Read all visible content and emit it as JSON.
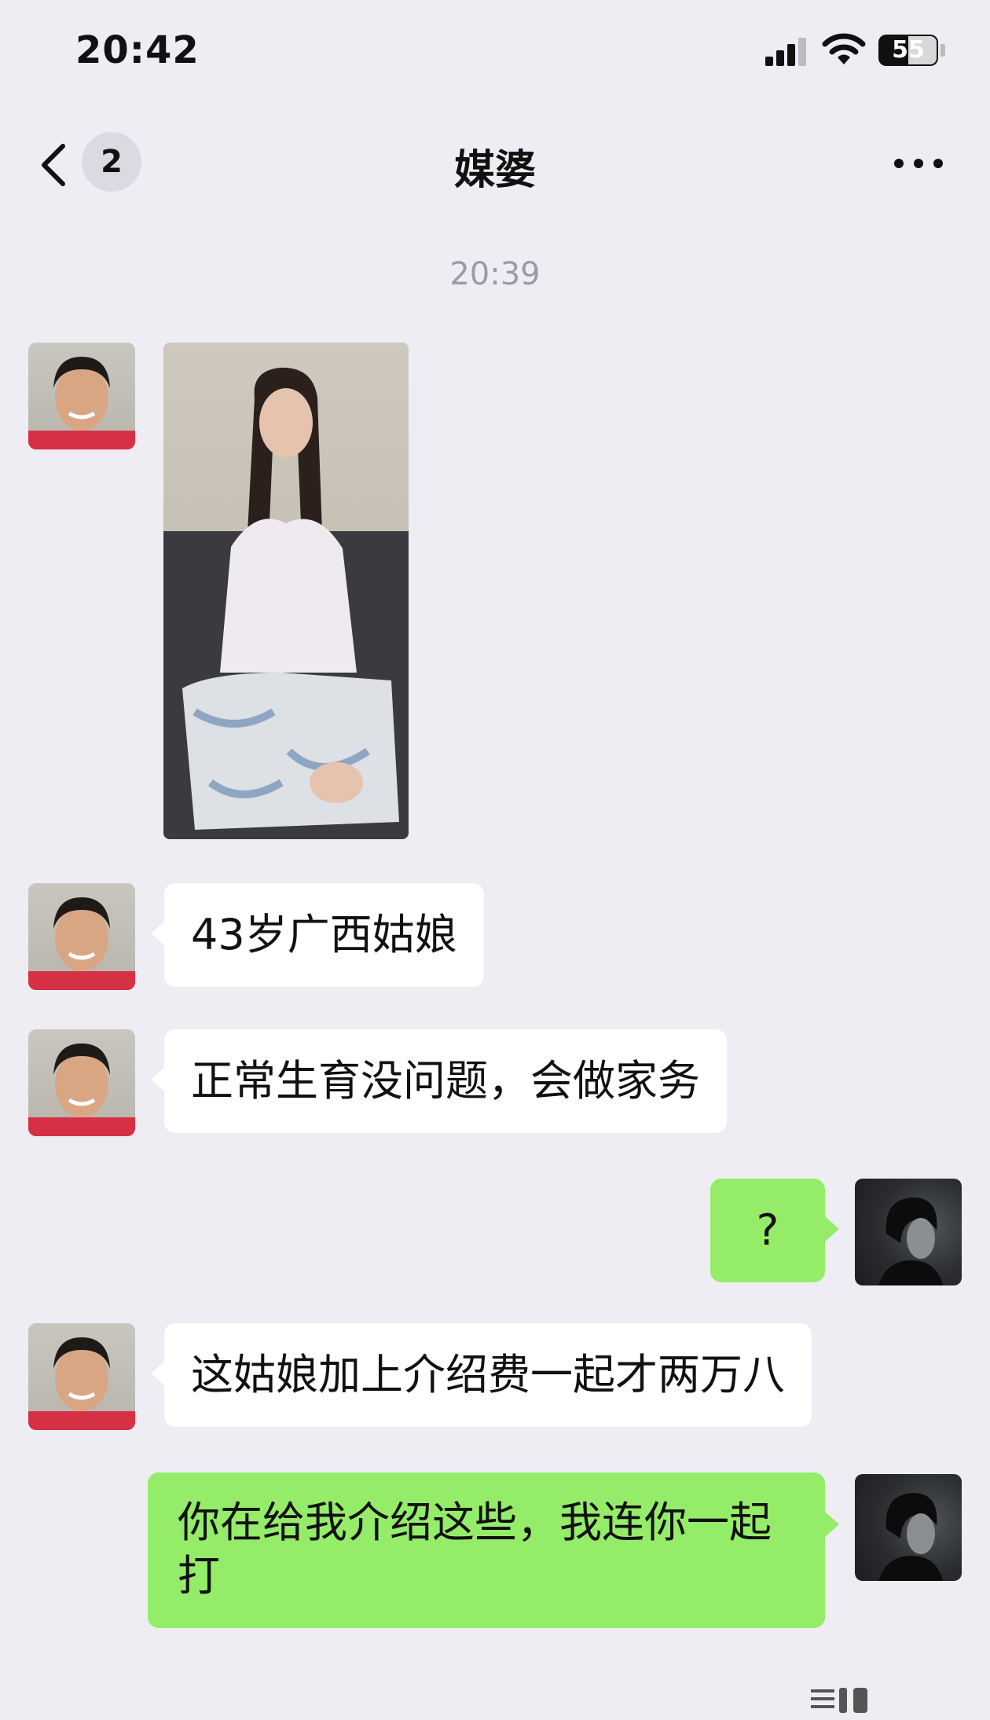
{
  "status_bar": {
    "time": "20:42",
    "battery": "55"
  },
  "nav": {
    "unread_count": "2",
    "title": "媒婆"
  },
  "chat": {
    "timestamp": "20:39",
    "messages": [
      {
        "sender": "matchmaker",
        "type": "image"
      },
      {
        "sender": "matchmaker",
        "type": "text",
        "text": "43岁广西姑娘"
      },
      {
        "sender": "matchmaker",
        "type": "text",
        "text": "正常生育没问题，会做家务"
      },
      {
        "sender": "me",
        "type": "text",
        "text": "?"
      },
      {
        "sender": "matchmaker",
        "type": "text",
        "text": "这姑娘加上介绍费一起才两万八"
      },
      {
        "sender": "me",
        "type": "text",
        "lines": [
          "你在给我介绍这些，我连你一起",
          "打"
        ]
      }
    ]
  },
  "colors": {
    "background": "#ededf3",
    "incoming_bubble": "#ffffff",
    "outgoing_bubble": "#95ec69"
  },
  "icons": [
    "signal-icon",
    "wifi-icon",
    "battery-icon",
    "back-chevron-icon",
    "more-icon"
  ]
}
